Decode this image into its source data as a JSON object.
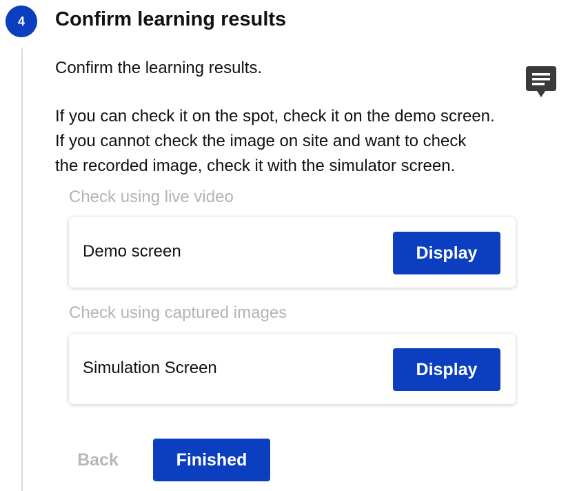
{
  "step": {
    "number": "4",
    "title": "Confirm learning results"
  },
  "intro": "Confirm the learning results.",
  "paragraph": [
    "If you can check it on the spot, check it on the demo screen.",
    "If you cannot check the image on site and want to check",
    "the recorded image, check it with the simulator screen."
  ],
  "sections": [
    {
      "label": "Check using live video",
      "card_label": "Demo screen",
      "button": "Display"
    },
    {
      "label": "Check using captured images",
      "card_label": "Simulation Screen",
      "button": "Display"
    }
  ],
  "actions": {
    "back": "Back",
    "finished": "Finished"
  },
  "icons": {
    "comment": "comment-icon"
  },
  "colors": {
    "accent": "#0b3fbf",
    "disabled_text": "#b8b8b8",
    "section_label": "#b3b3b3",
    "icon": "#3a3a3a"
  }
}
